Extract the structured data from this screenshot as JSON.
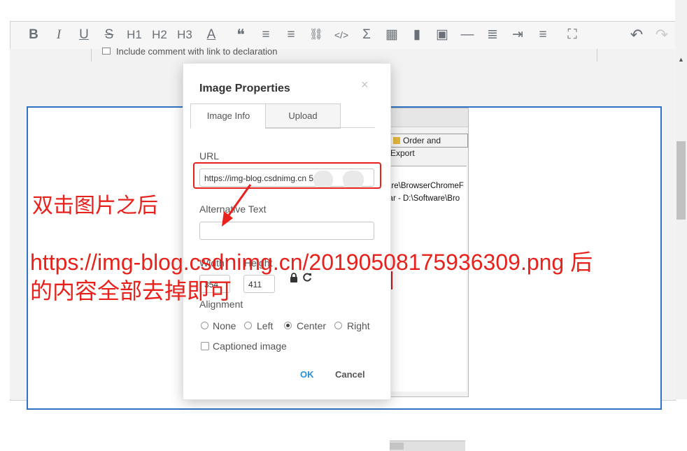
{
  "toolbar": {
    "buttons": [
      {
        "name": "bold",
        "glyph": "B"
      },
      {
        "name": "italic",
        "glyph": "I"
      },
      {
        "name": "underline",
        "glyph": "U"
      },
      {
        "name": "strikethrough",
        "glyph": "S"
      },
      {
        "name": "heading-1",
        "glyph": "H1"
      },
      {
        "name": "heading-2",
        "glyph": "H2"
      },
      {
        "name": "heading-3",
        "glyph": "H3"
      },
      {
        "name": "font-color",
        "glyph": "A"
      },
      {
        "name": "blockquote",
        "glyph": "❝"
      },
      {
        "name": "numbered-list",
        "glyph": "≡"
      },
      {
        "name": "bulleted-list",
        "glyph": "≡"
      },
      {
        "name": "link",
        "glyph": "⛓"
      },
      {
        "name": "code",
        "glyph": "</>"
      },
      {
        "name": "formula",
        "glyph": "Σ"
      },
      {
        "name": "table",
        "glyph": "▦"
      },
      {
        "name": "chart",
        "glyph": "▮"
      },
      {
        "name": "image",
        "glyph": "▣"
      },
      {
        "name": "horizontal-rule",
        "glyph": "―"
      },
      {
        "name": "page-break",
        "glyph": "≣"
      },
      {
        "name": "indent",
        "glyph": "⇥"
      },
      {
        "name": "list-style",
        "glyph": "≡"
      },
      {
        "name": "fullscreen",
        "glyph": "⛶"
      },
      {
        "name": "undo",
        "glyph": "↶"
      },
      {
        "name": "redo",
        "glyph": "↷"
      }
    ]
  },
  "background": {
    "behind_text": "Include comment with link to declaration",
    "inner_button_label": "Order and Export",
    "inner_list_lines": [
      "are\\BrowserChromeF",
      "jar - D:\\Software\\Bro"
    ]
  },
  "dialog": {
    "title": "Image Properties",
    "close_glyph": "×",
    "tabs": [
      "Image Info",
      "Upload"
    ],
    "url_label": "URL",
    "url_value": "https://img-blog.csdnimg.cn          50       03",
    "alt_label": "Alternative Text",
    "alt_value": "",
    "width_label": "Width",
    "height_label": "Height",
    "width_value": "354",
    "height_value": "411",
    "alignment_label": "Alignment",
    "alignment_options": [
      "None",
      "Left",
      "Center",
      "Right"
    ],
    "alignment_selected": "Center",
    "captioned_label": "Captioned image",
    "ok_label": "OK",
    "cancel_label": "Cancel"
  },
  "annotations": {
    "line1": "双击图片之后",
    "line2": "https://img-blog.csdnimg.cn/20190508175936309.png  后",
    "line3": "的内容全部去掉即可",
    "color": "#e8211c"
  }
}
